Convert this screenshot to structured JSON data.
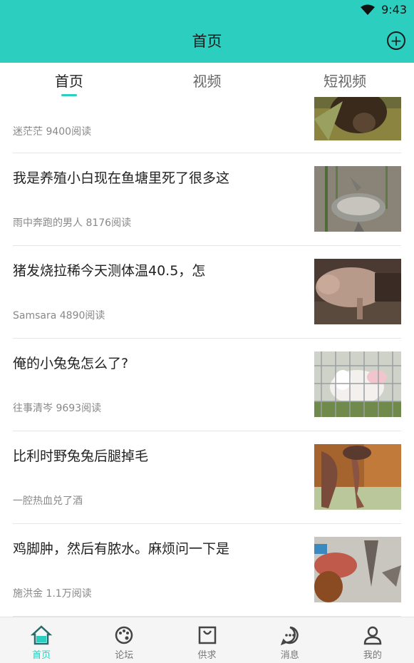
{
  "status": {
    "time": "9:43",
    "wifi_icon": "wifi-icon"
  },
  "header": {
    "title": "首页",
    "add_icon": "plus-circle-icon"
  },
  "tabs": [
    {
      "label": "首页",
      "active": true
    },
    {
      "label": "视频",
      "active": false
    },
    {
      "label": "短视频",
      "active": false
    }
  ],
  "posts": [
    {
      "title": "",
      "meta": "迷茫茫 9400阅读"
    },
    {
      "title": "我是养殖小白现在鱼塘里死了很多这",
      "meta": "雨中奔跑的男人 8176阅读"
    },
    {
      "title": "猪发烧拉稀今天测体温40.5，怎",
      "meta": "Samsara 4890阅读"
    },
    {
      "title": "俺的小兔兔怎么了?",
      "meta": "往事清岑 9693阅读"
    },
    {
      "title": "比利时野兔兔后腿掉毛",
      "meta": "一腔热血兑了酒"
    },
    {
      "title": "鸡脚肿，然后有脓水。麻烦问一下是",
      "meta": "施洪金 1.1万阅读"
    }
  ],
  "bottom_nav": [
    {
      "label": "首页",
      "icon": "home-icon",
      "active": true
    },
    {
      "label": "论坛",
      "icon": "palette-icon",
      "active": false
    },
    {
      "label": "供求",
      "icon": "bag-icon",
      "active": false
    },
    {
      "label": "消息",
      "icon": "chat-icon",
      "active": false
    },
    {
      "label": "我的",
      "icon": "user-icon",
      "active": false
    }
  ],
  "colors": {
    "accent": "#2ccfbf",
    "text": "#222222",
    "meta": "#888888"
  }
}
